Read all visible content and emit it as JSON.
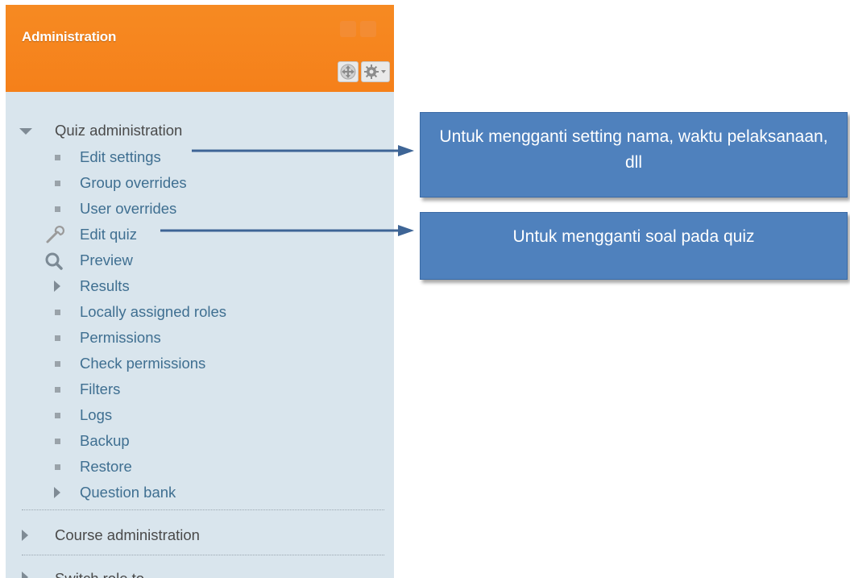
{
  "block": {
    "title": "Administration",
    "move_icon": "move-icon",
    "settings_icon": "gear-dropdown-icon"
  },
  "quiz_admin": {
    "label": "Quiz administration",
    "items": [
      {
        "label": "Edit settings",
        "icon": "bullet"
      },
      {
        "label": "Group overrides",
        "icon": "bullet"
      },
      {
        "label": "User overrides",
        "icon": "bullet"
      },
      {
        "label": "Edit quiz",
        "icon": "wrench-icon"
      },
      {
        "label": "Preview",
        "icon": "magnifier-icon"
      },
      {
        "label": "Results",
        "icon": "expand-arrow"
      },
      {
        "label": "Locally assigned roles",
        "icon": "bullet"
      },
      {
        "label": "Permissions",
        "icon": "bullet"
      },
      {
        "label": "Check permissions",
        "icon": "bullet"
      },
      {
        "label": "Filters",
        "icon": "bullet"
      },
      {
        "label": "Logs",
        "icon": "bullet"
      },
      {
        "label": "Backup",
        "icon": "bullet"
      },
      {
        "label": "Restore",
        "icon": "bullet"
      },
      {
        "label": "Question bank",
        "icon": "expand-arrow"
      }
    ]
  },
  "course_admin": {
    "label": "Course administration"
  },
  "switch_role": {
    "label": "Switch role to..."
  },
  "callouts": {
    "edit_settings": "Untuk mengganti setting nama, waktu pelaksanaan, dll",
    "edit_quiz": "Untuk mengganti soal pada quiz"
  },
  "colors": {
    "header": "#f68a22",
    "body": "#d9e5ed",
    "link": "#3f6f91",
    "callout": "#4f81bd",
    "arrow": "#3e6596"
  }
}
